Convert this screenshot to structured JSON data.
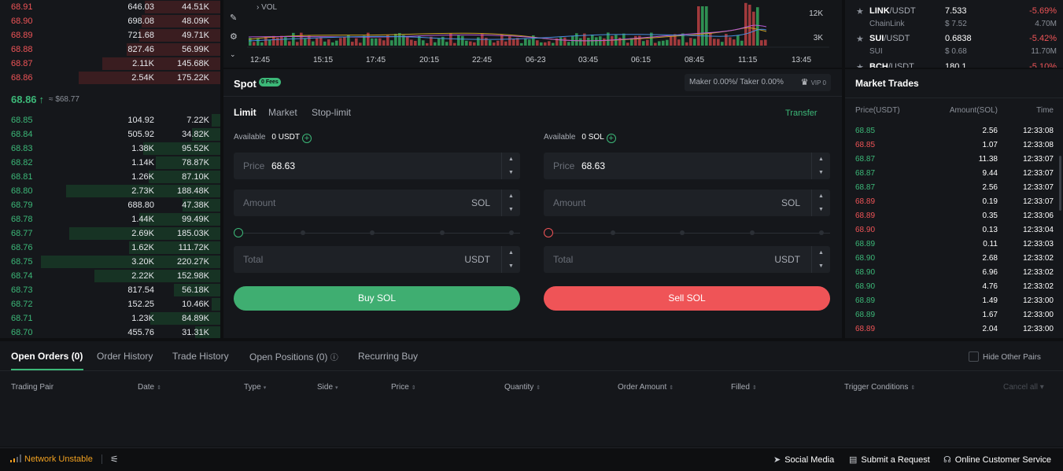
{
  "orderbook": {
    "asks": [
      {
        "price": "68.91",
        "amount": "646.03",
        "total": "44.51K",
        "depth": 0.42
      },
      {
        "price": "68.90",
        "amount": "698.08",
        "total": "48.09K",
        "depth": 0.44
      },
      {
        "price": "68.89",
        "amount": "721.68",
        "total": "49.71K",
        "depth": 0.45
      },
      {
        "price": "68.88",
        "amount": "827.46",
        "total": "56.99K",
        "depth": 0.52
      },
      {
        "price": "68.87",
        "amount": "2.11K",
        "total": "145.68K",
        "depth": 0.66
      },
      {
        "price": "68.86",
        "amount": "2.54K",
        "total": "175.22K",
        "depth": 0.79
      }
    ],
    "last_price": "68.86",
    "last_price_usd": "≈ $68.77",
    "bids": [
      {
        "price": "68.85",
        "amount": "104.92",
        "total": "7.22K",
        "depth": 0.05
      },
      {
        "price": "68.84",
        "amount": "505.92",
        "total": "34.82K",
        "depth": 0.16
      },
      {
        "price": "68.83",
        "amount": "1.38K",
        "total": "95.52K",
        "depth": 0.43
      },
      {
        "price": "68.82",
        "amount": "1.14K",
        "total": "78.87K",
        "depth": 0.36
      },
      {
        "price": "68.81",
        "amount": "1.26K",
        "total": "87.10K",
        "depth": 0.4
      },
      {
        "price": "68.80",
        "amount": "2.73K",
        "total": "188.48K",
        "depth": 0.86
      },
      {
        "price": "68.79",
        "amount": "688.80",
        "total": "47.38K",
        "depth": 0.21
      },
      {
        "price": "68.78",
        "amount": "1.44K",
        "total": "99.49K",
        "depth": 0.45
      },
      {
        "price": "68.77",
        "amount": "2.69K",
        "total": "185.03K",
        "depth": 0.84
      },
      {
        "price": "68.76",
        "amount": "1.62K",
        "total": "111.72K",
        "depth": 0.51
      },
      {
        "price": "68.75",
        "amount": "3.20K",
        "total": "220.27K",
        "depth": 1.0
      },
      {
        "price": "68.74",
        "amount": "2.22K",
        "total": "152.98K",
        "depth": 0.7
      },
      {
        "price": "68.73",
        "amount": "817.54",
        "total": "56.18K",
        "depth": 0.26
      },
      {
        "price": "68.72",
        "amount": "152.25",
        "total": "10.46K",
        "depth": 0.05
      },
      {
        "price": "68.71",
        "amount": "1.23K",
        "total": "84.89K",
        "depth": 0.39
      },
      {
        "price": "68.70",
        "amount": "455.76",
        "total": "31.31K",
        "depth": 0.14
      }
    ]
  },
  "chart": {
    "vol_label": "VOL",
    "y_labels": [
      "12K",
      "3K"
    ],
    "x_labels": [
      "12:45",
      "15:15",
      "17:45",
      "20:15",
      "22:45",
      "06-23",
      "03:45",
      "06:15",
      "08:45",
      "11:15",
      "13:45"
    ]
  },
  "spot": {
    "title": "Spot",
    "fee_badge": "0 Fees",
    "maker_taker": "Maker 0.00%/ Taker 0.00%",
    "vip_label": "VIP 0",
    "tabs": [
      "Limit",
      "Market",
      "Stop-limit"
    ],
    "transfer": "Transfer",
    "buy": {
      "available_label": "Available",
      "available_value": "0 USDT",
      "price_label": "Price",
      "price_value": "68.63",
      "amount_label": "Amount",
      "amount_unit": "SOL",
      "total_label": "Total",
      "total_unit": "USDT",
      "button": "Buy SOL",
      "accent": "#3cb878"
    },
    "sell": {
      "available_label": "Available",
      "available_value": "0 SOL",
      "price_label": "Price",
      "price_value": "68.63",
      "amount_label": "Amount",
      "amount_unit": "SOL",
      "total_label": "Total",
      "total_unit": "USDT",
      "button": "Sell SOL",
      "accent": "#ef5457"
    }
  },
  "markets": [
    {
      "base": "LINK",
      "quote": "/USDT",
      "name": "ChainLink",
      "price": "7.533",
      "usd": "$ 7.52",
      "change": "-5.69%",
      "volume": "4.70M"
    },
    {
      "base": "SUI",
      "quote": "/USDT",
      "name": "SUI",
      "price": "0.6838",
      "usd": "$ 0.68",
      "change": "-5.42%",
      "volume": "11.70M"
    },
    {
      "base": "BCH",
      "quote": "/USDT",
      "name": "",
      "price": "180.1",
      "usd": "",
      "change": "-5.10%",
      "volume": ""
    }
  ],
  "trades": {
    "title": "Market Trades",
    "headers": [
      "Price(USDT)",
      "Amount(SOL)",
      "Time"
    ],
    "rows": [
      {
        "price": "68.85",
        "amount": "2.56",
        "time": "12:33:08",
        "side": "up"
      },
      {
        "price": "68.85",
        "amount": "1.07",
        "time": "12:33:08",
        "side": "dn"
      },
      {
        "price": "68.87",
        "amount": "11.38",
        "time": "12:33:07",
        "side": "up"
      },
      {
        "price": "68.87",
        "amount": "9.44",
        "time": "12:33:07",
        "side": "up"
      },
      {
        "price": "68.87",
        "amount": "2.56",
        "time": "12:33:07",
        "side": "up"
      },
      {
        "price": "68.89",
        "amount": "0.19",
        "time": "12:33:07",
        "side": "dn"
      },
      {
        "price": "68.89",
        "amount": "0.35",
        "time": "12:33:06",
        "side": "dn"
      },
      {
        "price": "68.90",
        "amount": "0.13",
        "time": "12:33:04",
        "side": "dn"
      },
      {
        "price": "68.89",
        "amount": "0.11",
        "time": "12:33:03",
        "side": "up"
      },
      {
        "price": "68.90",
        "amount": "2.68",
        "time": "12:33:02",
        "side": "up"
      },
      {
        "price": "68.90",
        "amount": "6.96",
        "time": "12:33:02",
        "side": "up"
      },
      {
        "price": "68.90",
        "amount": "4.76",
        "time": "12:33:02",
        "side": "up"
      },
      {
        "price": "68.89",
        "amount": "1.49",
        "time": "12:33:00",
        "side": "up"
      },
      {
        "price": "68.89",
        "amount": "1.67",
        "time": "12:33:00",
        "side": "up"
      },
      {
        "price": "68.89",
        "amount": "2.04",
        "time": "12:33:00",
        "side": "dn"
      }
    ]
  },
  "orders": {
    "tabs": [
      "Open Orders (0)",
      "Order History",
      "Trade History",
      "Open Positions (0)",
      "Recurring Buy"
    ],
    "hide_other_pairs": "Hide Other Pairs",
    "columns": [
      "Trading Pair",
      "Date",
      "Type",
      "Side",
      "Price",
      "Quantity",
      "Order Amount",
      "Filled",
      "Trigger Conditions"
    ],
    "cancel_all": "Cancel all"
  },
  "footer": {
    "network": "Network Unstable",
    "social": "Social Media",
    "request": "Submit a Request",
    "support": "Online Customer Service"
  },
  "colors": {
    "up": "#3cb878",
    "down": "#ef5457",
    "warning": "#f0a020"
  }
}
